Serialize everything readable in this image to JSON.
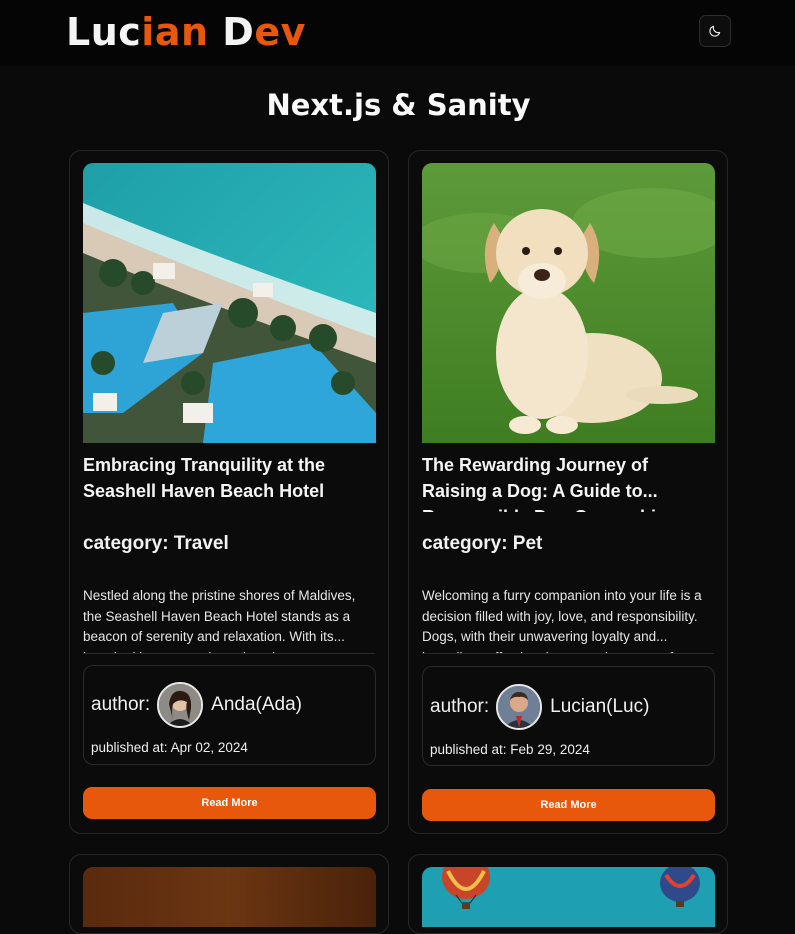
{
  "header": {
    "logo_part1": "Luc",
    "logo_part2": "ian",
    "logo_part3": " D",
    "logo_part4": "ev",
    "theme_toggle_icon": "moon-icon"
  },
  "page": {
    "title": "Next.js & Sanity"
  },
  "posts": [
    {
      "title": "Embracing Tranquility at the Seashell Haven Beach Hotel",
      "category": "category: Travel",
      "excerpt": "Nestled along the pristine shores of Maldives, the Seashell Haven Beach Hotel stands as a beacon of serenity and relaxation. With its... breathtaking ocean views, luxurious",
      "author_label": "author:",
      "author_name": "Anda(Ada)",
      "published": "published at: Apr 02, 2024",
      "button": "Read More",
      "image_icon": "beach-resort-image"
    },
    {
      "title": "The Rewarding Journey of Raising a Dog: A Guide to... Responsible Dog Ownership",
      "category": "category: Pet",
      "excerpt": "Welcoming a furry companion into your life is a decision filled with joy, love, and responsibility. Dogs, with their unwavering loyalty and... boundless affection, have a unique way of",
      "author_label": "author:",
      "author_name": "Lucian(Luc)",
      "published": "published at: Feb 29, 2024",
      "button": "Read More",
      "image_icon": "puppy-image"
    }
  ],
  "partial_posts": [
    {
      "image_icon": "dark-orange-image"
    },
    {
      "image_icon": "hot-air-balloons-image"
    }
  ],
  "colors": {
    "accent": "#e8580c",
    "background": "#0b0a0a",
    "header": "#050505"
  }
}
